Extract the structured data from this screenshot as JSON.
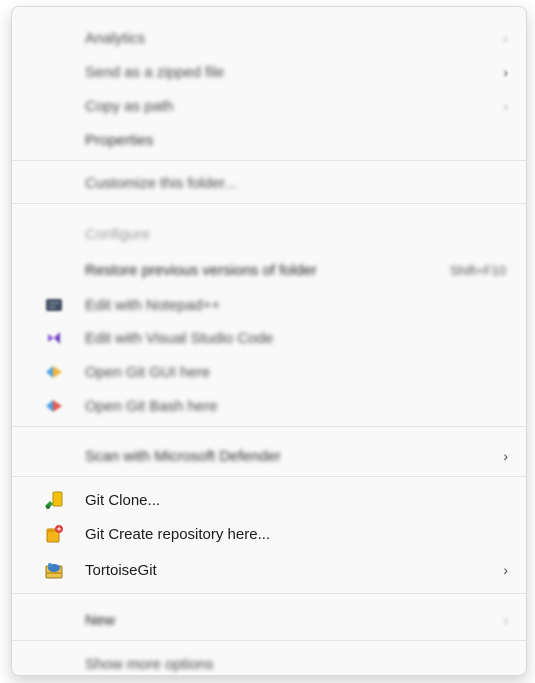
{
  "menu": {
    "items": [
      {
        "label": "Analytics",
        "blurred": true,
        "disabled": false,
        "has_submenu": true,
        "submenu_dim": true
      },
      {
        "label": "Send as a zipped file",
        "blurred": true,
        "disabled": false,
        "has_submenu": true
      },
      {
        "label": "Copy as path",
        "blurred": true,
        "disabled": false,
        "has_submenu": true,
        "submenu_dim": true
      },
      {
        "label": "Properties",
        "blurred": true,
        "disabled": false
      },
      {
        "label": "Customize this folder...",
        "blurred": true,
        "disabled": false
      },
      {
        "label": "Configure",
        "blurred": true,
        "disabled": true
      },
      {
        "label": "Restore previous versions of folder",
        "blurred": true,
        "disabled": false,
        "shortcut": "Shift+F10"
      },
      {
        "label": "Edit with Notepad++",
        "blurred": true,
        "disabled": false,
        "icon": "notepad-icon"
      },
      {
        "label": "Edit with Visual Studio Code",
        "blurred": true,
        "disabled": false,
        "icon": "visual-studio-icon"
      },
      {
        "label": "Open Git GUI here",
        "blurred": true,
        "disabled": false,
        "icon": "git-gui-icon"
      },
      {
        "label": "Open Git Bash here",
        "blurred": true,
        "disabled": false,
        "icon": "git-bash-icon"
      },
      {
        "label": "Scan with Microsoft Defender",
        "blurred": true,
        "disabled": false,
        "has_submenu": true
      },
      {
        "label": "Git Clone...",
        "blurred": false,
        "disabled": false,
        "icon": "git-clone-icon"
      },
      {
        "label": "Git Create repository here...",
        "blurred": false,
        "disabled": false,
        "icon": "git-create-repo-icon"
      },
      {
        "label": "TortoiseGit",
        "blurred": false,
        "disabled": false,
        "icon": "tortoisegit-icon",
        "has_submenu": true
      },
      {
        "label": "New",
        "blurred": true,
        "disabled": false,
        "has_submenu": true,
        "submenu_dim": true
      },
      {
        "label": "Show more options",
        "blurred": true,
        "disabled": false
      }
    ]
  },
  "icons": {
    "chevron": "›"
  }
}
